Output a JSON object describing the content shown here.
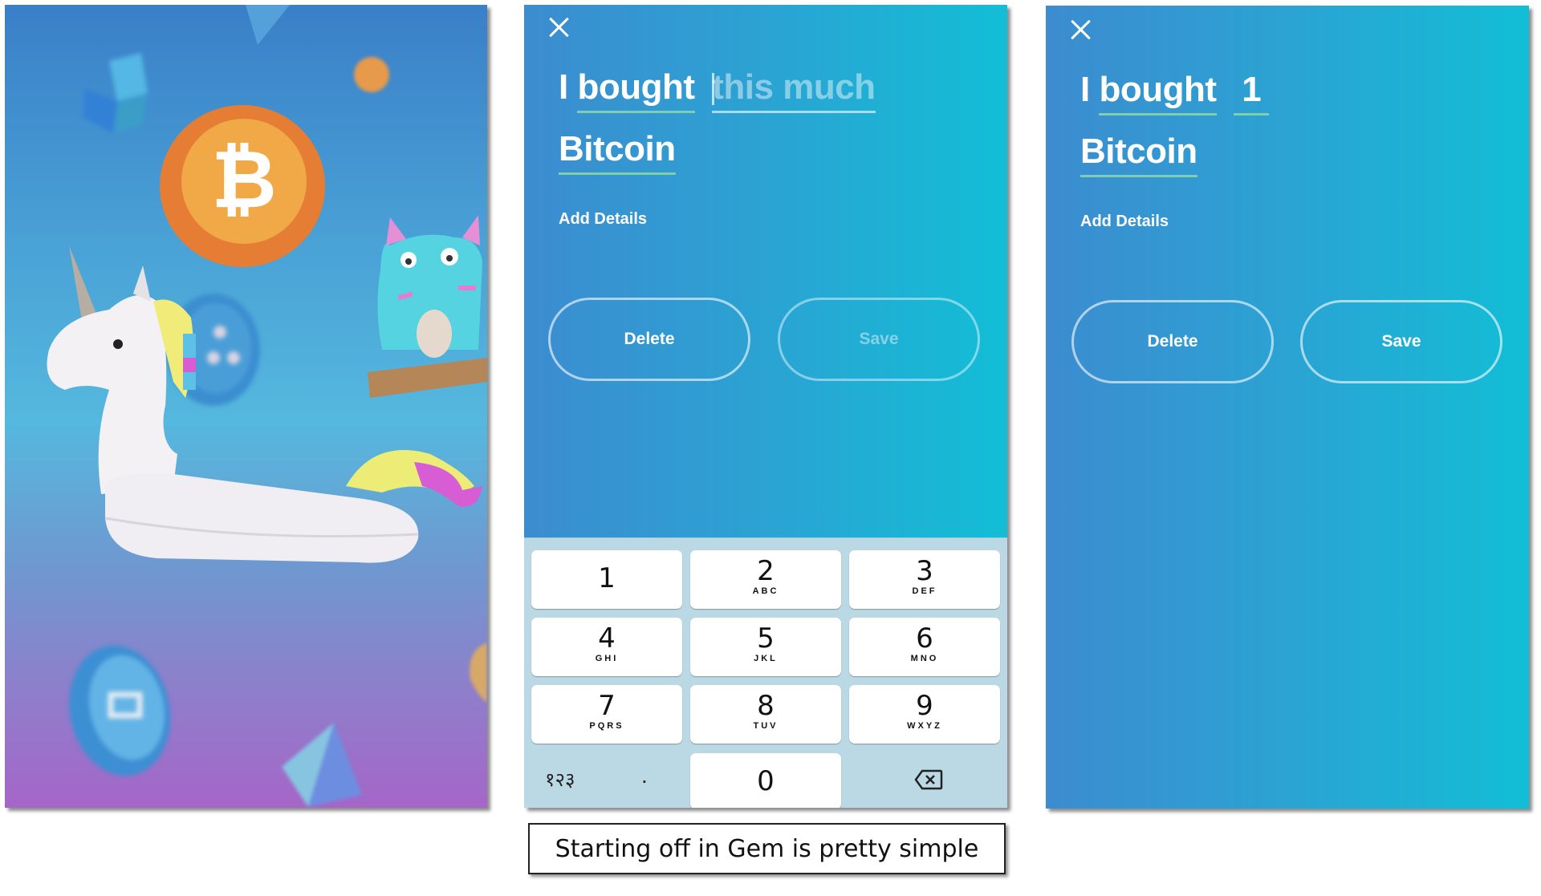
{
  "illustration": {
    "description": "Gem app welcome artwork",
    "items": [
      "bitcoin-coin",
      "unicorn-float",
      "cryptokitty-on-shelf",
      "ripple-coin",
      "dash-coin",
      "gem-crystal"
    ],
    "colors": {
      "gradient_top": "#3a7fc8",
      "gradient_mid": "#55b8de",
      "gradient_bottom": "#a566c8",
      "bitcoin_orange": "#e8863a"
    }
  },
  "entry_screen": {
    "close_icon": "close-icon",
    "sentence_prefix": "I",
    "verb": "bought",
    "amount_value": "",
    "amount_placeholder": "this much",
    "asset": "Bitcoin",
    "add_details": "Add Details",
    "delete_label": "Delete",
    "save_label": "Save",
    "save_enabled": false
  },
  "keypad": {
    "keys": [
      {
        "digit": "1",
        "letters": ""
      },
      {
        "digit": "2",
        "letters": "ABC"
      },
      {
        "digit": "3",
        "letters": "DEF"
      },
      {
        "digit": "4",
        "letters": "GHI"
      },
      {
        "digit": "5",
        "letters": "JKL"
      },
      {
        "digit": "6",
        "letters": "MNO"
      },
      {
        "digit": "7",
        "letters": "PQRS"
      },
      {
        "digit": "8",
        "letters": "TUV"
      },
      {
        "digit": "9",
        "letters": "WXYZ"
      },
      {
        "digit": "0",
        "letters": ""
      }
    ],
    "alt_numerals": "१२३",
    "decimal": ".",
    "backspace_icon": "backspace-icon",
    "colors": {
      "background": "#bad9e5",
      "key": "#ffffff"
    }
  },
  "filled_screen": {
    "close_icon": "close-icon",
    "sentence_prefix": "I",
    "verb": "bought",
    "amount_value": "1",
    "asset": "Bitcoin",
    "add_details": "Add Details",
    "delete_label": "Delete",
    "save_label": "Save",
    "save_enabled": true
  },
  "theme": {
    "gradient_left": "#3c8ccf",
    "gradient_right": "#12bed6",
    "underline": "#7fcfae",
    "text": "#ffffff"
  },
  "caption": "Starting off in Gem is pretty simple"
}
